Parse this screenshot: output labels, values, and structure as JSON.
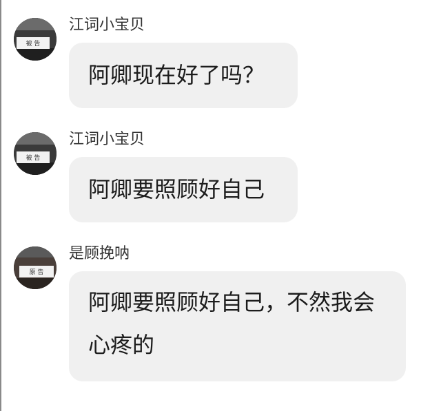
{
  "messages": [
    {
      "sender": "江词小宝贝",
      "text": "阿卿现在好了吗？",
      "avatar_sign": "被 告"
    },
    {
      "sender": "江词小宝贝",
      "text": "阿卿要照顾好自己",
      "avatar_sign": "被 告"
    },
    {
      "sender": "是顾挽呐",
      "text": "阿卿要照顾好自己，不然我会心疼的",
      "avatar_sign": "原 告"
    }
  ],
  "colors": {
    "bubble": "#f0f0f0",
    "text": "#1c1c1c",
    "sender": "#333333"
  }
}
